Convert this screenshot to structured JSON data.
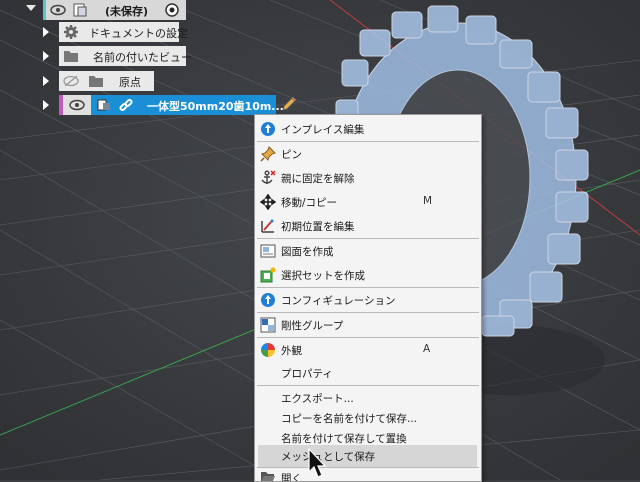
{
  "browser": {
    "root": {
      "label": "(未保存)"
    },
    "items": [
      {
        "label": "ドキュメントの設定"
      },
      {
        "label": "名前の付いたビュー"
      },
      {
        "label": "原点"
      },
      {
        "label": "一体型50mm20歯10m..."
      }
    ]
  },
  "context_menu": {
    "items": [
      {
        "label": "インプレイス編集",
        "key": ""
      },
      {
        "label": "ピン",
        "key": ""
      },
      {
        "label": "親に固定を解除",
        "key": ""
      },
      {
        "label": "移動/コピー",
        "key": "M"
      },
      {
        "label": "初期位置を編集",
        "key": ""
      },
      {
        "label": "図面を作成",
        "key": ""
      },
      {
        "label": "選択セットを作成",
        "key": ""
      },
      {
        "label": "コンフィギュレーション",
        "key": ""
      },
      {
        "label": "剛性グループ",
        "key": ""
      },
      {
        "label": "外観",
        "key": "A"
      },
      {
        "label": "プロパティ",
        "key": ""
      },
      {
        "label": "エクスポート...",
        "key": ""
      },
      {
        "label": "コピーを名前を付けて保存...",
        "key": ""
      },
      {
        "label": "名前を付けて保存して置換",
        "key": ""
      },
      {
        "label": "メッシュとして保存",
        "key": ""
      },
      {
        "label": "開く",
        "key": ""
      }
    ]
  },
  "colors": {
    "selection": "#1a8fd6",
    "canvas": "#3a3c40",
    "model": "#aac6ea"
  }
}
